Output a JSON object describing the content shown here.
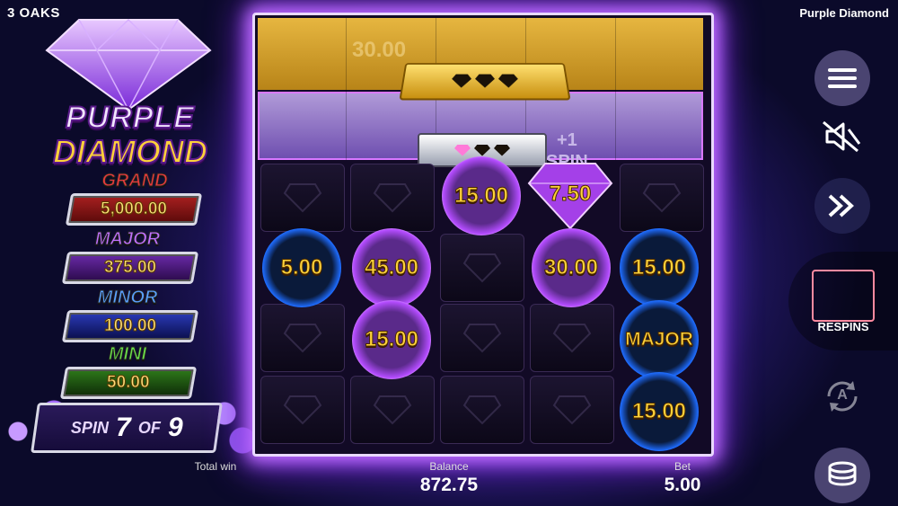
{
  "header": {
    "studio": "3 OAKS",
    "game_name": "Purple Diamond"
  },
  "logo": {
    "line1": "PURPLE",
    "line2": "DIAMOND"
  },
  "jackpots": [
    {
      "name": "GRAND",
      "value": "5,000.00",
      "title_color": "#e63b3b",
      "box_color": "#7a1414"
    },
    {
      "name": "MAJOR",
      "value": "375.00",
      "title_color": "#c070ff",
      "box_color": "#4a1a7a"
    },
    {
      "name": "MINOR",
      "value": "100.00",
      "title_color": "#5aa0ff",
      "box_color": "#13206e"
    },
    {
      "name": "MINI",
      "value": "50.00",
      "title_color": "#6be04a",
      "box_color": "#1e4a12"
    }
  ],
  "spin_counter": {
    "spin_word": "SPIN",
    "current": "7",
    "of_word": "OF",
    "total": "9"
  },
  "reels": {
    "ghost_value": "30.00",
    "bonus_label_line1": "+1",
    "bonus_label_line2": "SPIN",
    "gold_bar_filled": 0,
    "gold_bar_total": 3,
    "silver_bar_filled": 1,
    "silver_bar_total": 3,
    "orbs": [
      {
        "value": "15.00",
        "style": "pur"
      },
      {
        "value": "7.50",
        "style": "gem"
      },
      {
        "value": "5.00",
        "style": "blue"
      },
      {
        "value": "45.00",
        "style": "pur"
      },
      {
        "value": "30.00",
        "style": "pur"
      },
      {
        "value": "15.00",
        "style": "blue"
      },
      {
        "value": "15.00",
        "style": "pur"
      },
      {
        "value": "MAJOR",
        "style": "blue"
      },
      {
        "value": "15.00",
        "style": "blue"
      }
    ]
  },
  "controls": {
    "respins_label": "RESPINS",
    "autoplay_letter": "A"
  },
  "footer": {
    "total_win_label": "Total win",
    "balance_label": "Balance",
    "balance_value": "872.75",
    "bet_label": "Bet",
    "bet_value": "5.00"
  },
  "colors": {
    "accent_gold": "#ffd23a",
    "frame_glow": "#c070ff"
  }
}
